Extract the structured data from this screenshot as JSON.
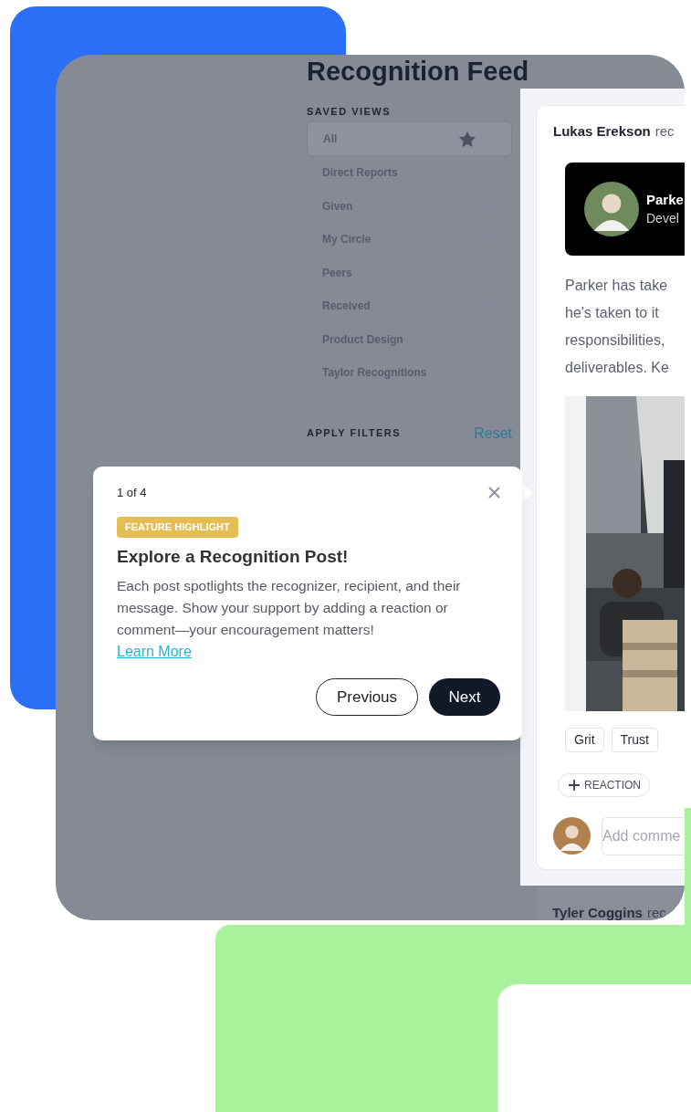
{
  "title": "Recognition Feed",
  "saved_views": {
    "heading": "SAVED VIEWS",
    "items": [
      {
        "label": "All",
        "selected": true,
        "starred": true
      },
      {
        "label": "Direct Reports",
        "selected": false,
        "starred": false
      },
      {
        "label": "Given",
        "selected": false,
        "starred": false
      },
      {
        "label": "My Circle",
        "selected": false,
        "starred": false
      },
      {
        "label": "Peers",
        "selected": false,
        "starred": false
      },
      {
        "label": "Received",
        "selected": false,
        "starred": false
      },
      {
        "label": "Product Design",
        "selected": false,
        "starred": false
      },
      {
        "label": "Taylor Recognitions",
        "selected": false,
        "starred": false
      }
    ]
  },
  "filters": {
    "heading": "APPLY FILTERS",
    "reset": "Reset"
  },
  "post": {
    "author": "Lukas Erekson",
    "verb": "rec",
    "recipient": {
      "name": "Parke",
      "role": "Devel"
    },
    "message_lines": [
      "Parker has take",
      "he's taken to it",
      "responsibilities,",
      "deliverables. Ke"
    ],
    "tags": [
      "Grit",
      "Trust"
    ],
    "reaction_button": "REACTION",
    "comment": {
      "placeholder": "Add comme"
    }
  },
  "next_post": {
    "author": "Tyler Coggins",
    "verb": "rec"
  },
  "tour": {
    "step": "1 of 4",
    "badge": "FEATURE HIGHLIGHT",
    "title": "Explore a Recognition Post!",
    "body": "Each post spotlights the recognizer, recipient, and their message. Show your support by adding a reaction or comment—your encouragement matters!",
    "link": "Learn More",
    "buttons": [
      {
        "label": "Previous",
        "kind": "secondary"
      },
      {
        "label": "Next",
        "kind": "primary"
      }
    ]
  }
}
